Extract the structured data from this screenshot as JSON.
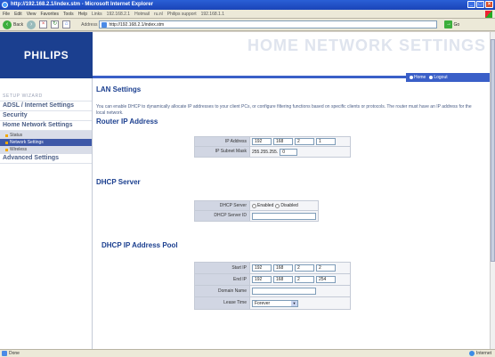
{
  "window": {
    "title": "http://192.168.2.1/index.stm - Microsoft Internet Explorer",
    "min": "_",
    "max": "□",
    "close": "×"
  },
  "menu": {
    "items": [
      "File",
      "Edit",
      "View",
      "Favorites",
      "Tools",
      "Help"
    ],
    "links_label": "Links",
    "links": [
      "192.168.2.1",
      "Hotmail",
      "ru.nl",
      "Philips support",
      "192.168.1.1"
    ]
  },
  "toolbar": {
    "back": "Back",
    "address_label": "Address",
    "address_value": "http://192.168.2.1/index.stm",
    "go": "Go"
  },
  "header": {
    "logo": "PHILIPS",
    "title": "HOME NETWORK SETTINGS",
    "home_link": "Home",
    "logout_link": "Logout"
  },
  "sidebar": {
    "wizard": "SETUP WIZARD",
    "items": [
      "ADSL / Internet Settings",
      "Security",
      "Home Network Settings"
    ],
    "sub_items": [
      "Status",
      "Network Settings",
      "Wireless"
    ],
    "advanced": "Advanced Settings"
  },
  "main": {
    "title": "LAN Settings",
    "description": "You can enable DHCP to dynamically allocate IP addresses to your client PCs, or configure filtering functions based on specific clients or protocols. The router must have an IP address for the local network.",
    "router_section": "Router IP Address",
    "ip_label": "IP Address",
    "ip": [
      "192",
      "168",
      "2",
      "1"
    ],
    "mask_label": "IP Subnet Mask",
    "mask_prefix": "255.255.255.",
    "mask_last": "0",
    "dhcp_section": "DHCP Server",
    "dhcp_label": "DHCP Server",
    "dhcp_enabled": "Enabled",
    "dhcp_disabled": "Disabled",
    "dhcp_id_label": "DHCP Server ID",
    "pool_section": "DHCP IP Address Pool",
    "start_label": "Start IP",
    "start_ip": [
      "192",
      "168",
      "2",
      "2"
    ],
    "end_label": "End IP",
    "end_ip": [
      "192",
      "168",
      "2",
      "254"
    ],
    "domain_label": "Domain Name",
    "lease_label": "Lease Time",
    "lease_value": "Forever"
  },
  "status": {
    "text": "Done",
    "zone": "Internet"
  }
}
